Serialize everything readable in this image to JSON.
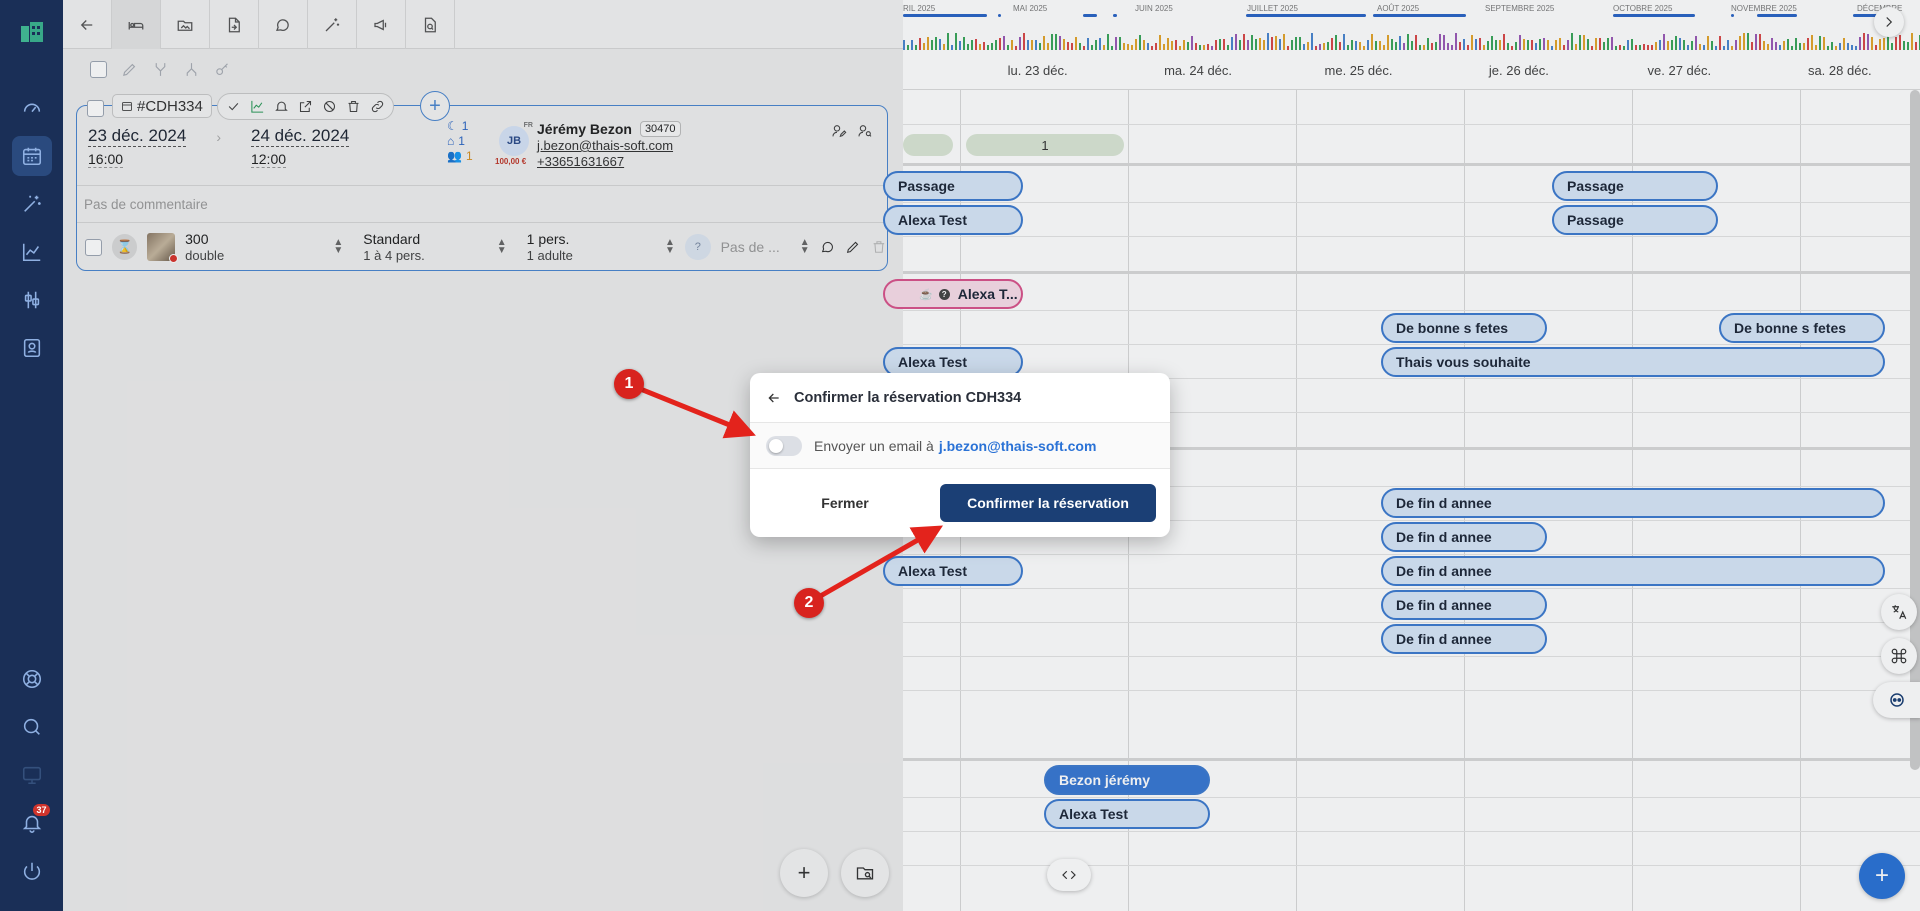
{
  "sidebar": {
    "notifications_count": "37"
  },
  "reservation": {
    "code": "#CDH334",
    "arrival_date": "23 déc. 2024",
    "arrival_time": "16:00",
    "departure_date": "24 déc. 2024",
    "departure_time": "12:00",
    "nights": "1",
    "rooms": "1",
    "persons": "1",
    "guest_initials": "JB",
    "guest_flag": "FR",
    "amount": "100,00 €",
    "guest_name": "Jérémy Bezon",
    "guest_id": "30470",
    "guest_email": "j.bezon@thais-soft.com",
    "guest_phone": "+33651631667",
    "comment_placeholder": "Pas de commentaire",
    "room_number": "300",
    "room_type": "double",
    "rate_name": "Standard",
    "rate_capacity": "1 à 4 pers.",
    "occupancy": "1 pers.",
    "occupancy_detail": "1 adulte",
    "rate_plan_placeholder": "Pas de ...",
    "rate_question": "?"
  },
  "timeline": {
    "months": [
      "RIL 2025",
      "MAI 2025",
      "JUIN 2025",
      "JUILLET 2025",
      "AOÛT 2025",
      "SEPTEMBRE 2025",
      "OCTOBRE 2025",
      "NOVEMBRE 2025",
      "DÉCEMBRE"
    ]
  },
  "calendar": {
    "days": [
      "",
      "lu. 23 déc.",
      "ma. 24 déc.",
      "me. 25 déc.",
      "je. 26 déc.",
      "ve. 27 déc.",
      "sa. 28 déc."
    ],
    "count_pill": "1",
    "bookings": {
      "passage": "Passage",
      "alexa_test": "Alexa Test",
      "alexa_short": "Alexa T...",
      "bonnes_fetes": "De bonne s fetes",
      "thais_souhaite": "Thais vous souhaite",
      "fin_annee": "De fin d annee",
      "bezon_jeremy": "Bezon jérémy"
    }
  },
  "modal": {
    "title": "Confirmer la réservation CDH334",
    "email_label": "Envoyer un email à",
    "email_address": "j.bezon@thais-soft.com",
    "email_toggle_on": false,
    "close_label": "Fermer",
    "confirm_label": "Confirmer la réservation"
  },
  "annotations": {
    "marker_1": "1",
    "marker_2": "2",
    "arrow_color": "#e3231c"
  }
}
